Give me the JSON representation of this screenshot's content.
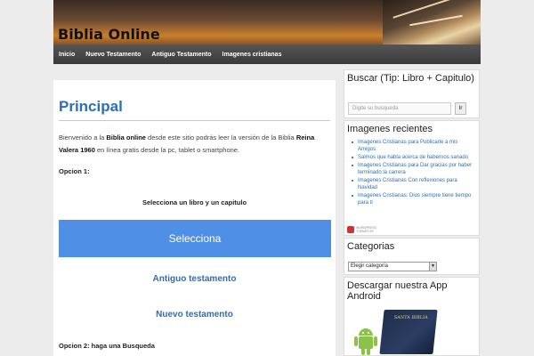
{
  "site": {
    "title": "Biblia Online"
  },
  "nav": {
    "items": [
      "Inicio",
      "Nuevo Testamento",
      "Antiguo Testamento",
      "Imagenes cristianas"
    ]
  },
  "main": {
    "heading": "Principal",
    "intro_prefix": "Bienvenido a la ",
    "intro_bold1": "Biblia online",
    "intro_mid": " desde este sitio podrás leer la versión de la Biblia ",
    "intro_bold2": "Reina Valera 1960",
    "intro_suffix": " en línea gratis desde la pc, tablet o smartphone.",
    "option1": "Opcion 1:",
    "select_prompt": "Selecciona un libro y un capitulo",
    "select_button": "Selecciona",
    "link_old": "Antiguo testamento",
    "link_new": "Nuevo testamento",
    "option2": "Opcion 2: haga una Busqueda"
  },
  "sidebar": {
    "search": {
      "title": "Buscar (Tip: Libro + Capitulo)",
      "placeholder": "Digite su busqueda",
      "button": "Ir"
    },
    "images": {
      "title": "Imagenes recientes",
      "items": [
        "Imagenes Cristianas para Publicarle a mis Amigos",
        "Salmos que habla acerca de habernos sanado",
        "Imagenes Cristianas para Dar gracias por haber terminado la carrera",
        "Imagenes Cristianas Con reflexiones para Navidad",
        "Imagenes Cristianas: Dios siempre tiene tiempo para ti"
      ],
      "powered": "WORDPRESS THEMES BY"
    },
    "categories": {
      "title": "Categorias",
      "selected": "Elegir categoría"
    },
    "app": {
      "title": "Descargar nuestra App Android",
      "bible_label": "SANTA BIBLIA"
    }
  },
  "colors": {
    "accent": "#2d6fb6",
    "button": "#4f8fe6",
    "nav": "#3a3a3a"
  }
}
